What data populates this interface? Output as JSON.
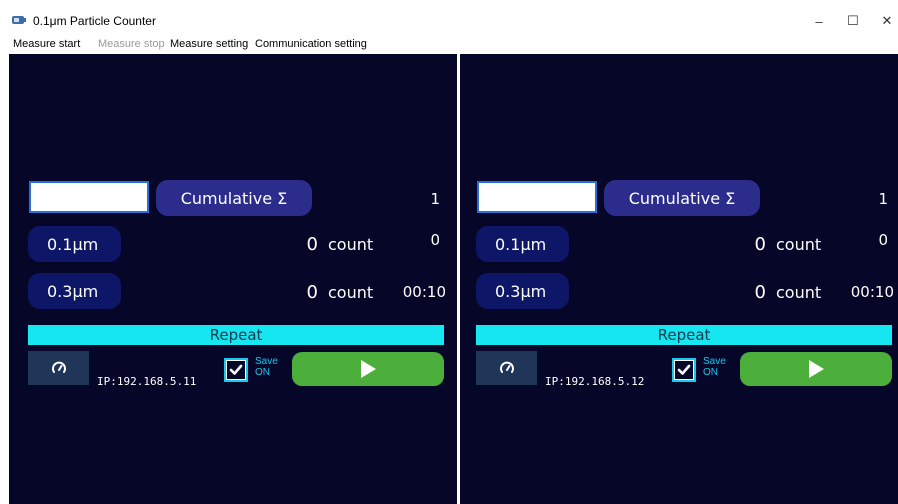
{
  "window": {
    "title": "0.1μm Particle Counter",
    "controls": {
      "minimize": "–",
      "maximize": "☐",
      "close": "✕"
    }
  },
  "menu": {
    "items": [
      {
        "label": "Measure start",
        "enabled": true
      },
      {
        "label": "Measure stop",
        "enabled": false
      },
      {
        "label": "Measure setting",
        "enabled": true
      },
      {
        "label": "Communication setting",
        "enabled": true
      }
    ]
  },
  "panels": [
    {
      "name_value": "",
      "cumulative_label": "Cumulative Σ",
      "index": "1",
      "rows": [
        {
          "size_label": "0.1μm",
          "count": "0",
          "unit": "count",
          "right_value": "0"
        },
        {
          "size_label": "0.3μm",
          "count": "0",
          "unit": "count",
          "right_value": "00:10"
        }
      ],
      "repeat_label": "Repeat",
      "ip": "IP:192.168.5.11",
      "save_label_1": "Save",
      "save_label_2": "ON",
      "save_checked": true
    },
    {
      "name_value": "",
      "cumulative_label": "Cumulative Σ",
      "index": "1",
      "rows": [
        {
          "size_label": "0.1μm",
          "count": "0",
          "unit": "count",
          "right_value": "0"
        },
        {
          "size_label": "0.3μm",
          "count": "0",
          "unit": "count",
          "right_value": "00:10"
        }
      ],
      "repeat_label": "Repeat",
      "ip": "IP:192.168.5.12",
      "save_label_1": "Save",
      "save_label_2": "ON",
      "save_checked": true
    }
  ],
  "colors": {
    "panel_bg": "#060628",
    "cumulative_button": "#2c2c8c",
    "size_button": "#0e1668",
    "repeat_bar": "#16e6ef",
    "play_button": "#4caf3c",
    "save_accent": "#19c8ee"
  },
  "icons": {
    "title": "window-app-icon",
    "gauge": "gauge-icon",
    "play": "play-icon",
    "check": "checkmark-icon"
  }
}
